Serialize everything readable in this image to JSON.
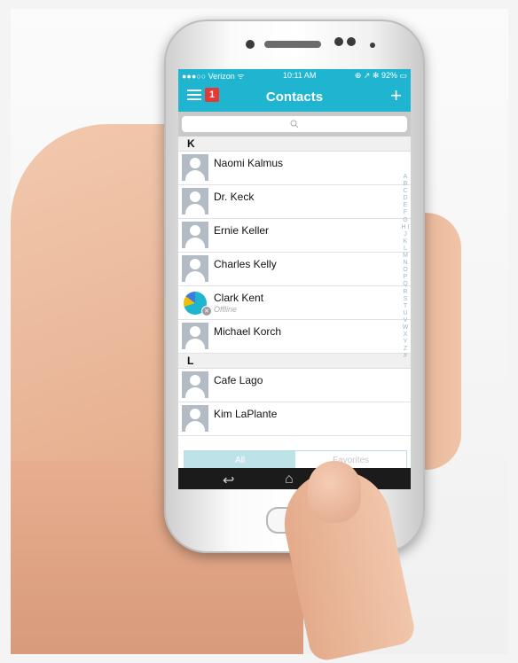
{
  "status_bar": {
    "carrier": "●●●○○ Verizon ᯤ",
    "time": "10:11 AM",
    "right": "⊕ ↗ ✻ 92% ▭"
  },
  "nav": {
    "badge": "1",
    "title": "Contacts",
    "add": "+"
  },
  "search": {
    "icon": "search-icon",
    "glyph": "⌕"
  },
  "contacts": {
    "section_k": "K",
    "section_l": "L",
    "k_items": [
      {
        "name": "Naomi Kalmus"
      },
      {
        "name": "Dr. Keck"
      },
      {
        "name": "Ernie Keller"
      },
      {
        "name": "Charles Kelly"
      },
      {
        "name": "Clark Kent",
        "status": "Offline"
      },
      {
        "name": "Michael Korch"
      }
    ],
    "l_items": [
      {
        "name": "Cafe Lago"
      },
      {
        "name": "Kim LaPlante"
      }
    ]
  },
  "index_letters": "A B C D E F G H I J K L M N O P Q R S T U V W X Y Z #",
  "tabs": {
    "all": "All",
    "favorites": "Favorites"
  },
  "android_keys": {
    "back": "↩",
    "home": "⌂",
    "recent": "▭"
  },
  "colors": {
    "accent": "#1fb5d0",
    "badge": "#e53935"
  }
}
